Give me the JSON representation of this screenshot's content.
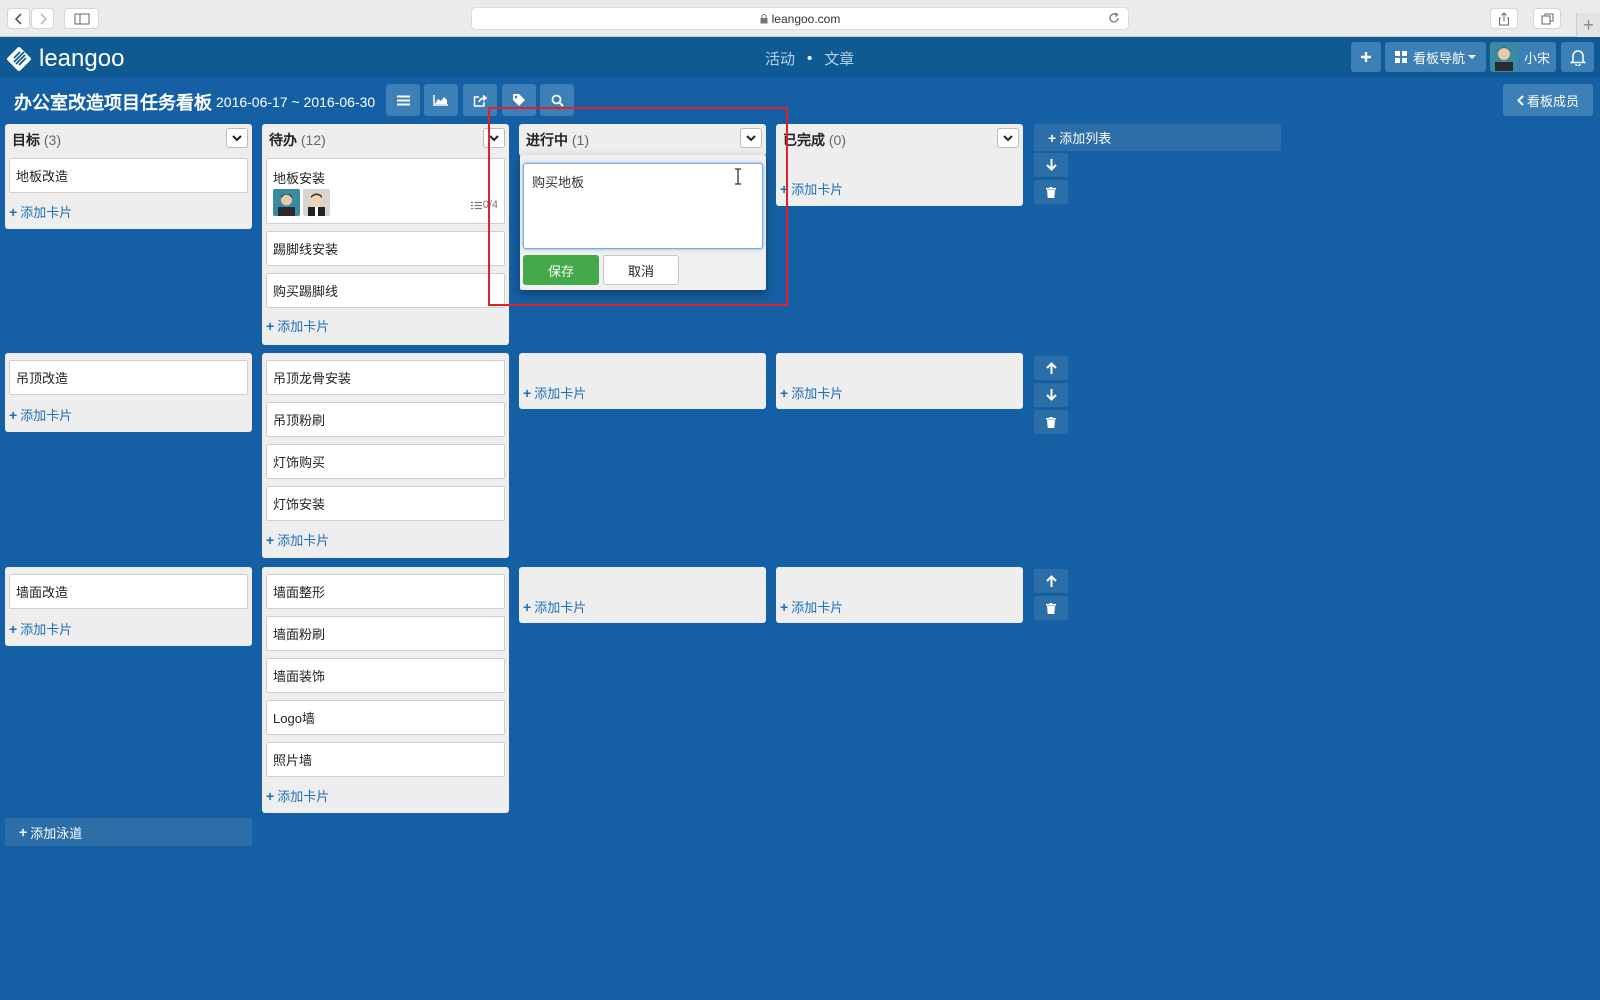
{
  "browser": {
    "url": "leangoo.com"
  },
  "topbar": {
    "logo_text": "leangoo",
    "nav_activity": "活动",
    "nav_separator": "•",
    "nav_article": "文章",
    "board_nav_label": "看板导航",
    "user_name": "小宋"
  },
  "board": {
    "title": "办公室改造项目任务看板",
    "dates": "2016-06-17 ~ 2016-06-30",
    "members_label": "看板成员",
    "add_list_label": "添加列表",
    "add_lane_label": "添加泳道",
    "add_card_label": "添加卡片"
  },
  "columns": [
    {
      "name": "目标",
      "count": "(3)"
    },
    {
      "name": "待办",
      "count": "(12)"
    },
    {
      "name": "进行中",
      "count": "(1)"
    },
    {
      "name": "已完成",
      "count": "(0)"
    }
  ],
  "lanes": [
    {
      "goal": [
        "地板改造"
      ],
      "todo": [
        "地板安装",
        "踢脚线安装",
        "购买踢脚线"
      ],
      "todo_checklist": "0/4"
    },
    {
      "goal": [
        "吊顶改造"
      ],
      "todo": [
        "吊顶龙骨安装",
        "吊顶粉刷",
        "灯饰购买",
        "灯饰安装"
      ]
    },
    {
      "goal": [
        "墙面改造"
      ],
      "todo": [
        "墙面整形",
        "墙面粉刷",
        "墙面装饰",
        "Logo墙",
        "照片墙"
      ]
    }
  ],
  "editor": {
    "text": "购买地板",
    "save_label": "保存",
    "cancel_label": "取消"
  },
  "colors": {
    "background": "#1560a4",
    "topbar": "#105a94",
    "save_green": "#44a949",
    "link_blue": "#1d6fb6",
    "highlight_red": "#e0202a"
  }
}
